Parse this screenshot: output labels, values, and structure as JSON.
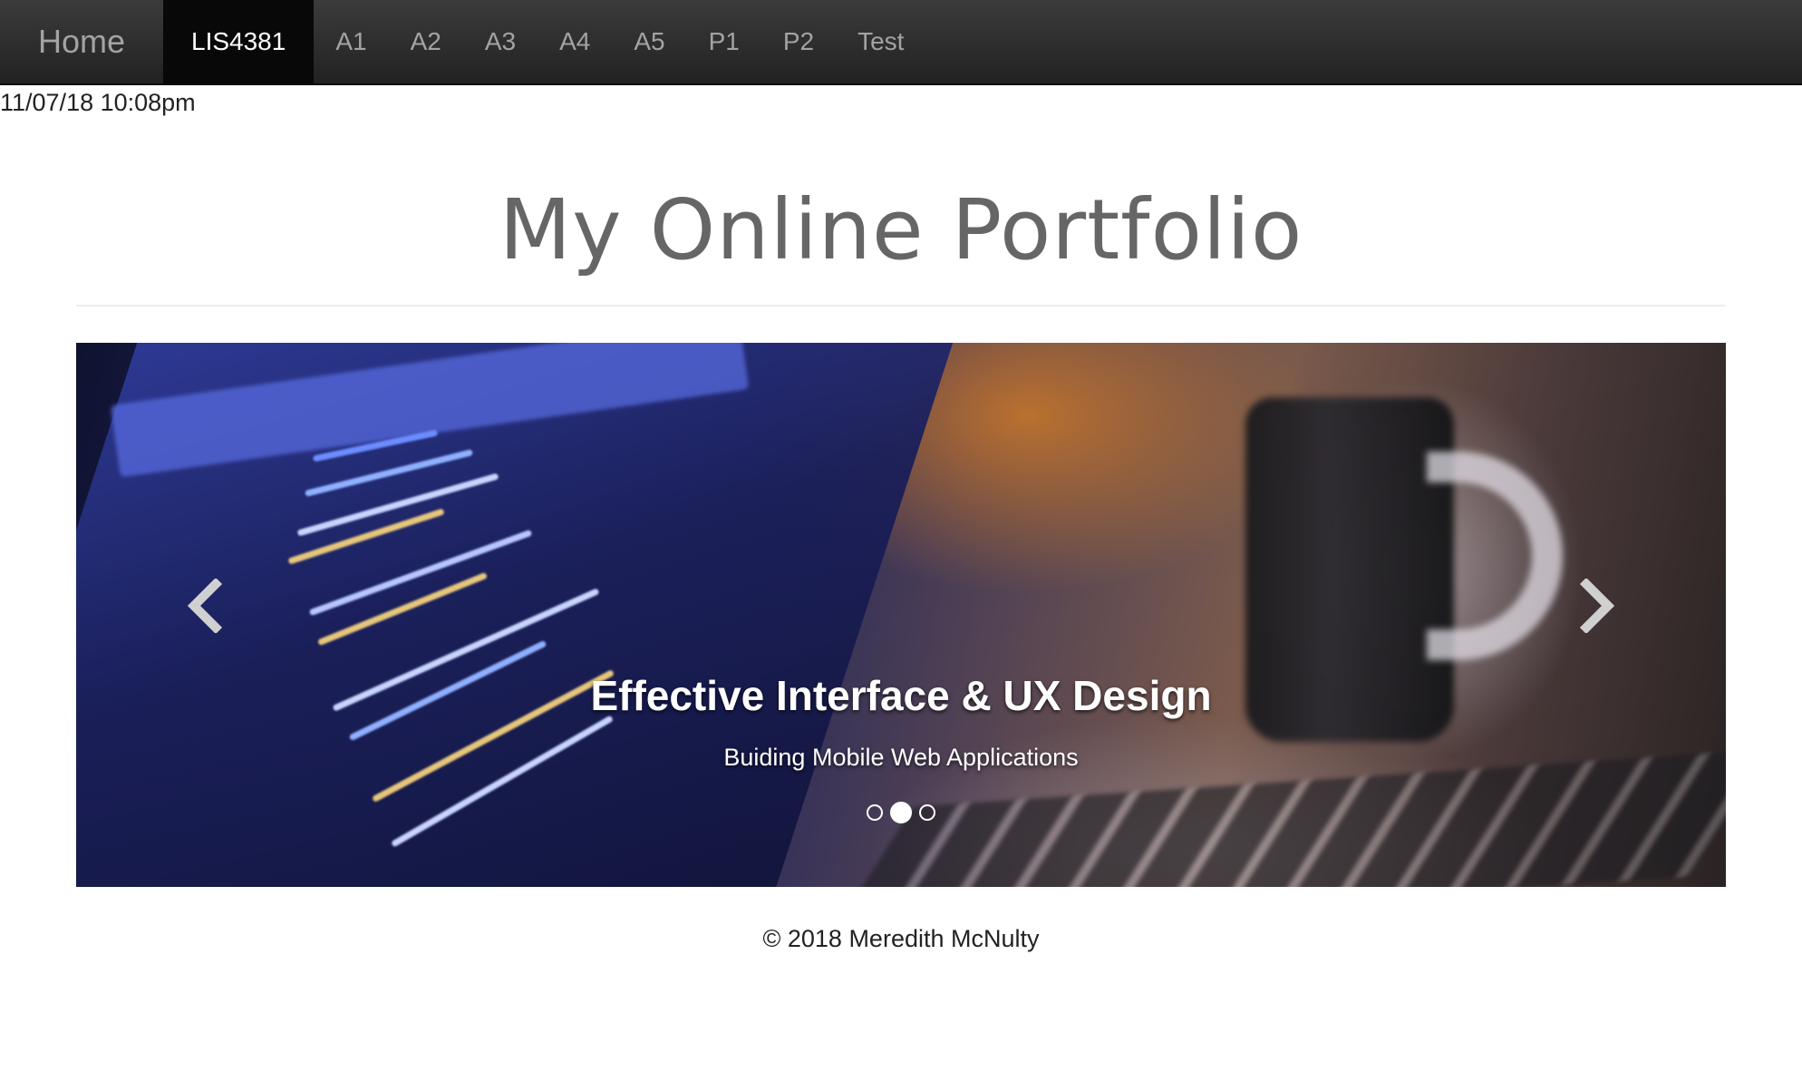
{
  "navbar": {
    "brand": "Home",
    "items": [
      {
        "label": "LIS4381",
        "active": true
      },
      {
        "label": "A1",
        "active": false
      },
      {
        "label": "A2",
        "active": false
      },
      {
        "label": "A3",
        "active": false
      },
      {
        "label": "A4",
        "active": false
      },
      {
        "label": "A5",
        "active": false
      },
      {
        "label": "P1",
        "active": false
      },
      {
        "label": "P2",
        "active": false
      },
      {
        "label": "Test",
        "active": false
      }
    ]
  },
  "timestamp": "11/07/18 10:08pm",
  "page": {
    "title": "My Online Portfolio"
  },
  "carousel": {
    "caption_title": "Effective Interface & UX Design",
    "caption_subtitle": "Buiding Mobile Web Applications",
    "slide_count": 3,
    "active_slide": 2,
    "prev_icon": "chevron-left-icon",
    "next_icon": "chevron-right-icon"
  },
  "footer": {
    "text": "© 2018 Meredith McNulty"
  },
  "colors": {
    "navbar_bg": "#222222",
    "nav_active_bg": "#080808",
    "nav_text": "#a3a3a3",
    "title_text": "#666666"
  }
}
